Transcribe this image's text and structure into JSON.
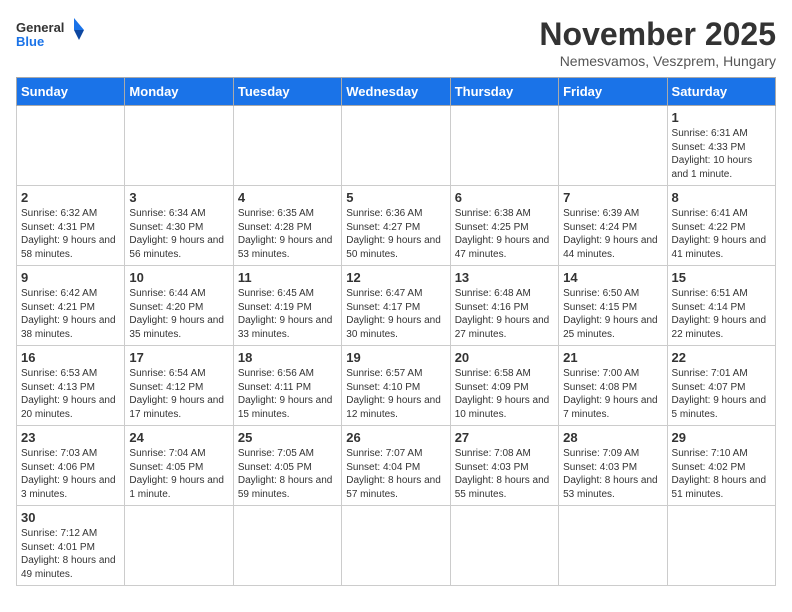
{
  "logo": {
    "general": "General",
    "blue": "Blue"
  },
  "title": "November 2025",
  "location": "Nemesvamos, Veszprem, Hungary",
  "days_of_week": [
    "Sunday",
    "Monday",
    "Tuesday",
    "Wednesday",
    "Thursday",
    "Friday",
    "Saturday"
  ],
  "weeks": [
    [
      {
        "day": "",
        "info": ""
      },
      {
        "day": "",
        "info": ""
      },
      {
        "day": "",
        "info": ""
      },
      {
        "day": "",
        "info": ""
      },
      {
        "day": "",
        "info": ""
      },
      {
        "day": "",
        "info": ""
      },
      {
        "day": "1",
        "info": "Sunrise: 6:31 AM\nSunset: 4:33 PM\nDaylight: 10 hours and 1 minute."
      }
    ],
    [
      {
        "day": "2",
        "info": "Sunrise: 6:32 AM\nSunset: 4:31 PM\nDaylight: 9 hours and 58 minutes."
      },
      {
        "day": "3",
        "info": "Sunrise: 6:34 AM\nSunset: 4:30 PM\nDaylight: 9 hours and 56 minutes."
      },
      {
        "day": "4",
        "info": "Sunrise: 6:35 AM\nSunset: 4:28 PM\nDaylight: 9 hours and 53 minutes."
      },
      {
        "day": "5",
        "info": "Sunrise: 6:36 AM\nSunset: 4:27 PM\nDaylight: 9 hours and 50 minutes."
      },
      {
        "day": "6",
        "info": "Sunrise: 6:38 AM\nSunset: 4:25 PM\nDaylight: 9 hours and 47 minutes."
      },
      {
        "day": "7",
        "info": "Sunrise: 6:39 AM\nSunset: 4:24 PM\nDaylight: 9 hours and 44 minutes."
      },
      {
        "day": "8",
        "info": "Sunrise: 6:41 AM\nSunset: 4:22 PM\nDaylight: 9 hours and 41 minutes."
      }
    ],
    [
      {
        "day": "9",
        "info": "Sunrise: 6:42 AM\nSunset: 4:21 PM\nDaylight: 9 hours and 38 minutes."
      },
      {
        "day": "10",
        "info": "Sunrise: 6:44 AM\nSunset: 4:20 PM\nDaylight: 9 hours and 35 minutes."
      },
      {
        "day": "11",
        "info": "Sunrise: 6:45 AM\nSunset: 4:19 PM\nDaylight: 9 hours and 33 minutes."
      },
      {
        "day": "12",
        "info": "Sunrise: 6:47 AM\nSunset: 4:17 PM\nDaylight: 9 hours and 30 minutes."
      },
      {
        "day": "13",
        "info": "Sunrise: 6:48 AM\nSunset: 4:16 PM\nDaylight: 9 hours and 27 minutes."
      },
      {
        "day": "14",
        "info": "Sunrise: 6:50 AM\nSunset: 4:15 PM\nDaylight: 9 hours and 25 minutes."
      },
      {
        "day": "15",
        "info": "Sunrise: 6:51 AM\nSunset: 4:14 PM\nDaylight: 9 hours and 22 minutes."
      }
    ],
    [
      {
        "day": "16",
        "info": "Sunrise: 6:53 AM\nSunset: 4:13 PM\nDaylight: 9 hours and 20 minutes."
      },
      {
        "day": "17",
        "info": "Sunrise: 6:54 AM\nSunset: 4:12 PM\nDaylight: 9 hours and 17 minutes."
      },
      {
        "day": "18",
        "info": "Sunrise: 6:56 AM\nSunset: 4:11 PM\nDaylight: 9 hours and 15 minutes."
      },
      {
        "day": "19",
        "info": "Sunrise: 6:57 AM\nSunset: 4:10 PM\nDaylight: 9 hours and 12 minutes."
      },
      {
        "day": "20",
        "info": "Sunrise: 6:58 AM\nSunset: 4:09 PM\nDaylight: 9 hours and 10 minutes."
      },
      {
        "day": "21",
        "info": "Sunrise: 7:00 AM\nSunset: 4:08 PM\nDaylight: 9 hours and 7 minutes."
      },
      {
        "day": "22",
        "info": "Sunrise: 7:01 AM\nSunset: 4:07 PM\nDaylight: 9 hours and 5 minutes."
      }
    ],
    [
      {
        "day": "23",
        "info": "Sunrise: 7:03 AM\nSunset: 4:06 PM\nDaylight: 9 hours and 3 minutes."
      },
      {
        "day": "24",
        "info": "Sunrise: 7:04 AM\nSunset: 4:05 PM\nDaylight: 9 hours and 1 minute."
      },
      {
        "day": "25",
        "info": "Sunrise: 7:05 AM\nSunset: 4:05 PM\nDaylight: 8 hours and 59 minutes."
      },
      {
        "day": "26",
        "info": "Sunrise: 7:07 AM\nSunset: 4:04 PM\nDaylight: 8 hours and 57 minutes."
      },
      {
        "day": "27",
        "info": "Sunrise: 7:08 AM\nSunset: 4:03 PM\nDaylight: 8 hours and 55 minutes."
      },
      {
        "day": "28",
        "info": "Sunrise: 7:09 AM\nSunset: 4:03 PM\nDaylight: 8 hours and 53 minutes."
      },
      {
        "day": "29",
        "info": "Sunrise: 7:10 AM\nSunset: 4:02 PM\nDaylight: 8 hours and 51 minutes."
      }
    ],
    [
      {
        "day": "30",
        "info": "Sunrise: 7:12 AM\nSunset: 4:01 PM\nDaylight: 8 hours and 49 minutes."
      },
      {
        "day": "",
        "info": ""
      },
      {
        "day": "",
        "info": ""
      },
      {
        "day": "",
        "info": ""
      },
      {
        "day": "",
        "info": ""
      },
      {
        "day": "",
        "info": ""
      },
      {
        "day": "",
        "info": ""
      }
    ]
  ]
}
